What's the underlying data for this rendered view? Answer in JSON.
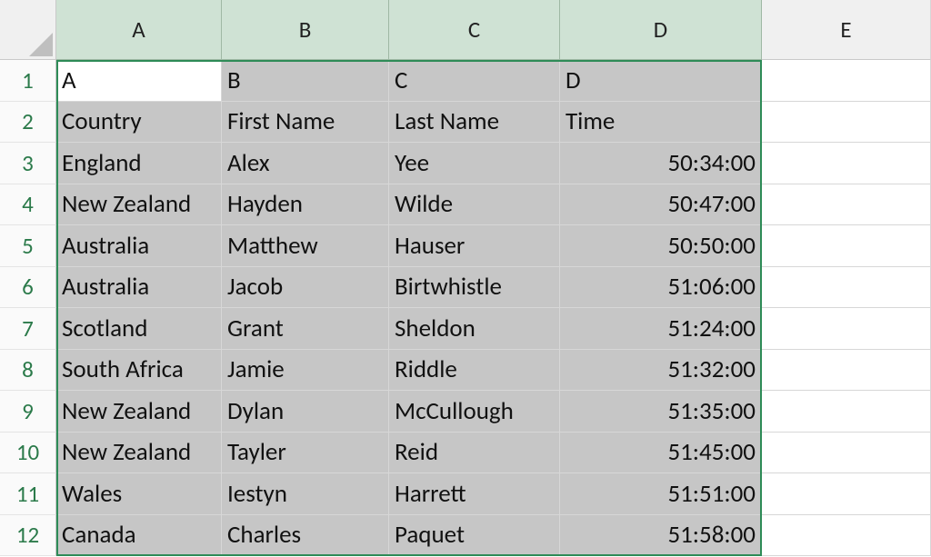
{
  "columns": [
    "A",
    "B",
    "C",
    "D",
    "E"
  ],
  "rows": [
    "1",
    "2",
    "3",
    "4",
    "5",
    "6",
    "7",
    "8",
    "9",
    "10",
    "11",
    "12"
  ],
  "selection": {
    "fromCol": 0,
    "toCol": 3,
    "fromRow": 0,
    "toRow": 11
  },
  "activeCell": {
    "col": 0,
    "row": 0
  },
  "chart_data": {
    "type": "table",
    "columns": [
      "A",
      "B",
      "C",
      "D"
    ],
    "rows": [
      [
        "A",
        "B",
        "C",
        "D"
      ],
      [
        "Country",
        "First Name",
        "Last Name",
        "Time"
      ],
      [
        "England",
        "Alex",
        "Yee",
        "50:34:00"
      ],
      [
        "New Zealand",
        "Hayden",
        "Wilde",
        "50:47:00"
      ],
      [
        "Australia",
        "Matthew",
        "Hauser",
        "50:50:00"
      ],
      [
        "Australia",
        "Jacob",
        "Birtwhistle",
        "51:06:00"
      ],
      [
        "Scotland",
        "Grant",
        "Sheldon",
        "51:24:00"
      ],
      [
        "South Africa",
        "Jamie",
        "Riddle",
        "51:32:00"
      ],
      [
        "New Zealand",
        "Dylan",
        "McCullough",
        "51:35:00"
      ],
      [
        "New Zealand",
        "Tayler",
        "Reid",
        "51:45:00"
      ],
      [
        "Wales",
        "Iestyn",
        "Harrett",
        "51:51:00"
      ],
      [
        "Canada",
        "Charles",
        "Paquet",
        "51:58:00"
      ]
    ]
  }
}
